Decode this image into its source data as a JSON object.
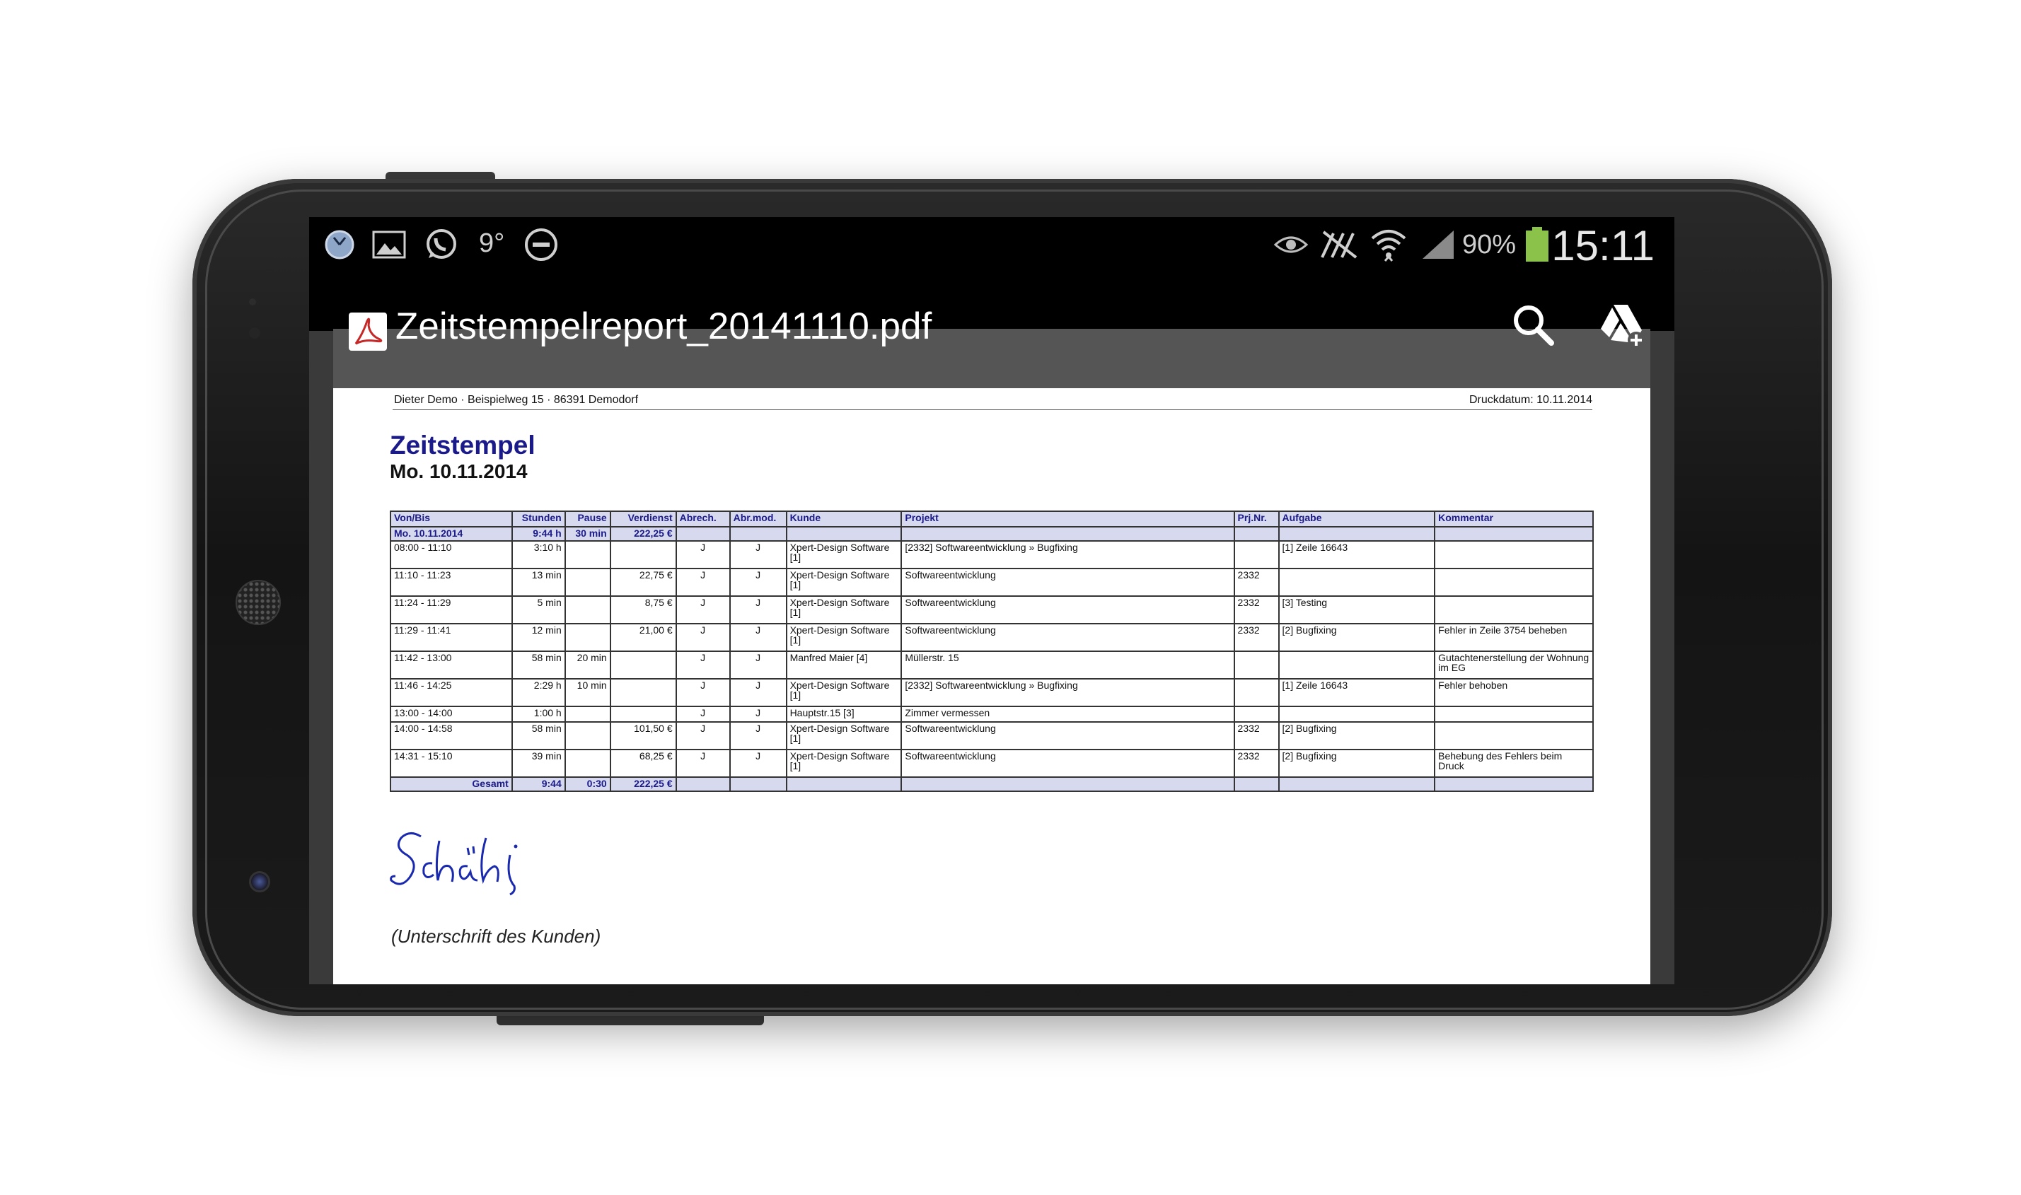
{
  "status_bar": {
    "temperature": "9°",
    "battery_percent": "90%",
    "time": "15:11",
    "icons": [
      "clock-icon",
      "gallery-icon",
      "whatsapp-icon",
      "do-not-disturb-icon",
      "eye-icon",
      "no-sim-icon",
      "wifi-icon",
      "signal-icon",
      "battery-icon"
    ]
  },
  "action_bar": {
    "file_title": "Zeitstempelreport_20141110.pdf",
    "icons": [
      "pdf-app-icon",
      "search-icon",
      "drive-add-icon"
    ]
  },
  "document": {
    "header_left": "Dieter Demo · Beispielweg 15 · 86391 Demodorf",
    "header_right": "Druckdatum: 10.11.2014",
    "title": "Zeitstempel",
    "date": "Mo. 10.11.2014",
    "columns": [
      "Von/Bis",
      "Stunden",
      "Pause",
      "Verdienst",
      "Abrech.",
      "Abr.mod.",
      "Kunde",
      "Projekt",
      "Prj.Nr.",
      "Aufgabe",
      "Kommentar"
    ],
    "day_row": [
      "Mo. 10.11.2014",
      "9:44 h",
      "30 min",
      "222,25 €",
      "",
      "",
      "",
      "",
      "",
      "",
      ""
    ],
    "rows": [
      [
        "08:00 - 11:10",
        "3:10 h",
        "",
        "",
        "J",
        "J",
        "Xpert-Design Software [1]",
        "[2332] Softwareentwicklung » Bugfixing",
        "",
        "[1] Zeile 16643",
        ""
      ],
      [
        "11:10 - 11:23",
        "13 min",
        "",
        "22,75 €",
        "J",
        "J",
        "Xpert-Design Software [1]",
        "Softwareentwicklung",
        "2332",
        "",
        ""
      ],
      [
        "11:24 - 11:29",
        "5 min",
        "",
        "8,75 €",
        "J",
        "J",
        "Xpert-Design Software [1]",
        "Softwareentwicklung",
        "2332",
        "[3] Testing",
        ""
      ],
      [
        "11:29 - 11:41",
        "12 min",
        "",
        "21,00 €",
        "J",
        "J",
        "Xpert-Design Software [1]",
        "Softwareentwicklung",
        "2332",
        "[2] Bugfixing",
        "Fehler in Zeile 3754 beheben"
      ],
      [
        "11:42 - 13:00",
        "58 min",
        "20 min",
        "",
        "J",
        "J",
        "Manfred Maier [4]",
        "Müllerstr. 15",
        "",
        "",
        "Gutachtenerstellung der Wohnung im EG"
      ],
      [
        "11:46 - 14:25",
        "2:29 h",
        "10 min",
        "",
        "J",
        "J",
        "Xpert-Design Software [1]",
        "[2332] Softwareentwicklung » Bugfixing",
        "",
        "[1] Zeile 16643",
        "Fehler behoben"
      ],
      [
        "13:00 - 14:00",
        "1:00 h",
        "",
        "",
        "J",
        "J",
        "Hauptstr.15 [3]",
        "Zimmer vermessen",
        "",
        "",
        ""
      ],
      [
        "14:00 - 14:58",
        "58 min",
        "",
        "101,50 €",
        "J",
        "J",
        "Xpert-Design Software [1]",
        "Softwareentwicklung",
        "2332",
        "[2] Bugfixing",
        ""
      ],
      [
        "14:31 - 15:10",
        "39 min",
        "",
        "68,25 €",
        "J",
        "J",
        "Xpert-Design Software [1]",
        "Softwareentwicklung",
        "2332",
        "[2] Bugfixing",
        "Behebung des Fehlers beim Druck"
      ]
    ],
    "total_row": [
      "Gesamt",
      "9:44",
      "0:30",
      "222,25 €",
      "",
      "",
      "",
      "",
      "",
      "",
      ""
    ],
    "signature_caption": "(Unterschrift des Kunden)"
  }
}
